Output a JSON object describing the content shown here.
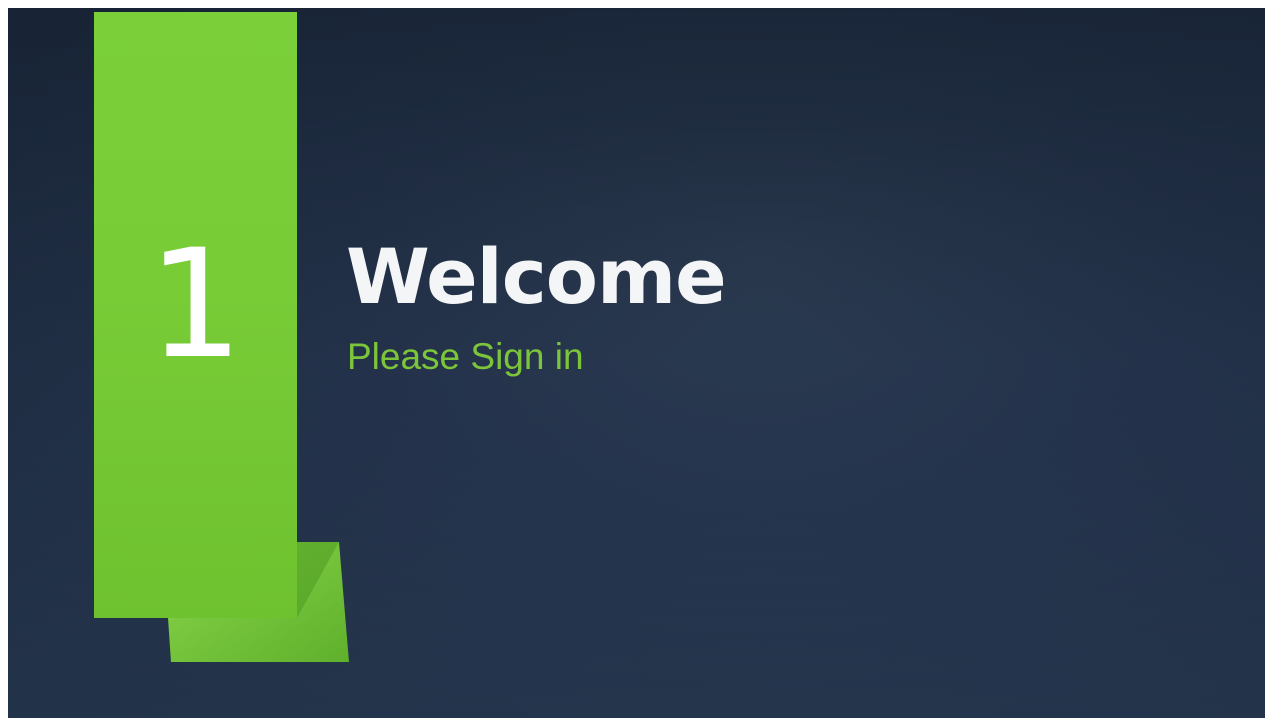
{
  "slide": {
    "section_number": "1",
    "title": "Welcome",
    "subtitle": "Please Sign in"
  },
  "colors": {
    "background": "#23324a",
    "accent_green": "#78cc36",
    "subtitle_green": "#7cc43a",
    "title_white": "#f4f5f7"
  }
}
